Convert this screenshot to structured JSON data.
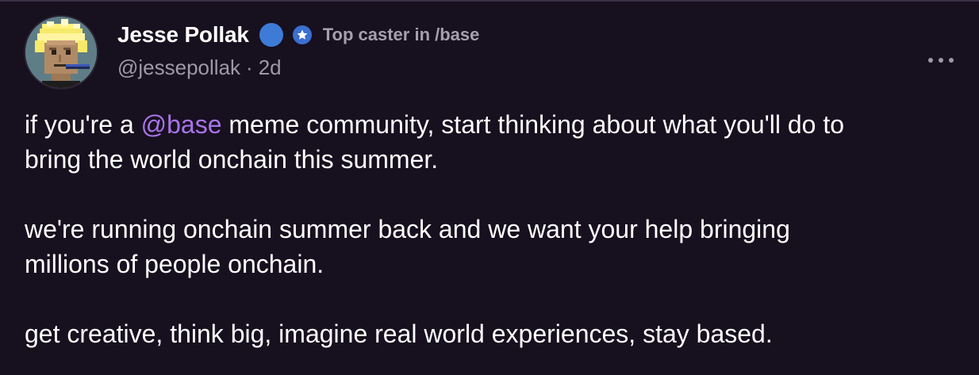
{
  "post": {
    "author": {
      "display_name": "Jesse Pollak",
      "handle": "@jessepollak",
      "age": "2d",
      "separator": "·",
      "badge_label": "Top caster in /base",
      "avatar_icon": "pixel-punk-avatar-icon",
      "verified_icon": "verified-badge-icon",
      "badge_icon": "star-badge-icon"
    },
    "more_icon": "ellipsis-icon",
    "paragraphs": [
      {
        "before": "if you're a ",
        "mention": "@base",
        "after": " meme community, start thinking about what you'll do to",
        "line2": "bring the world onchain this summer."
      },
      {
        "line1": "we're running onchain summer back and we want your help bringing",
        "line2": "millions of people onchain."
      },
      {
        "line1": "get creative, think big, imagine real world experiences, stay based."
      }
    ]
  },
  "colors": {
    "background": "#17101f",
    "text": "#ffffff",
    "muted": "#9f98a8",
    "mention": "#a974e8",
    "verified": "#3d7bd6"
  }
}
